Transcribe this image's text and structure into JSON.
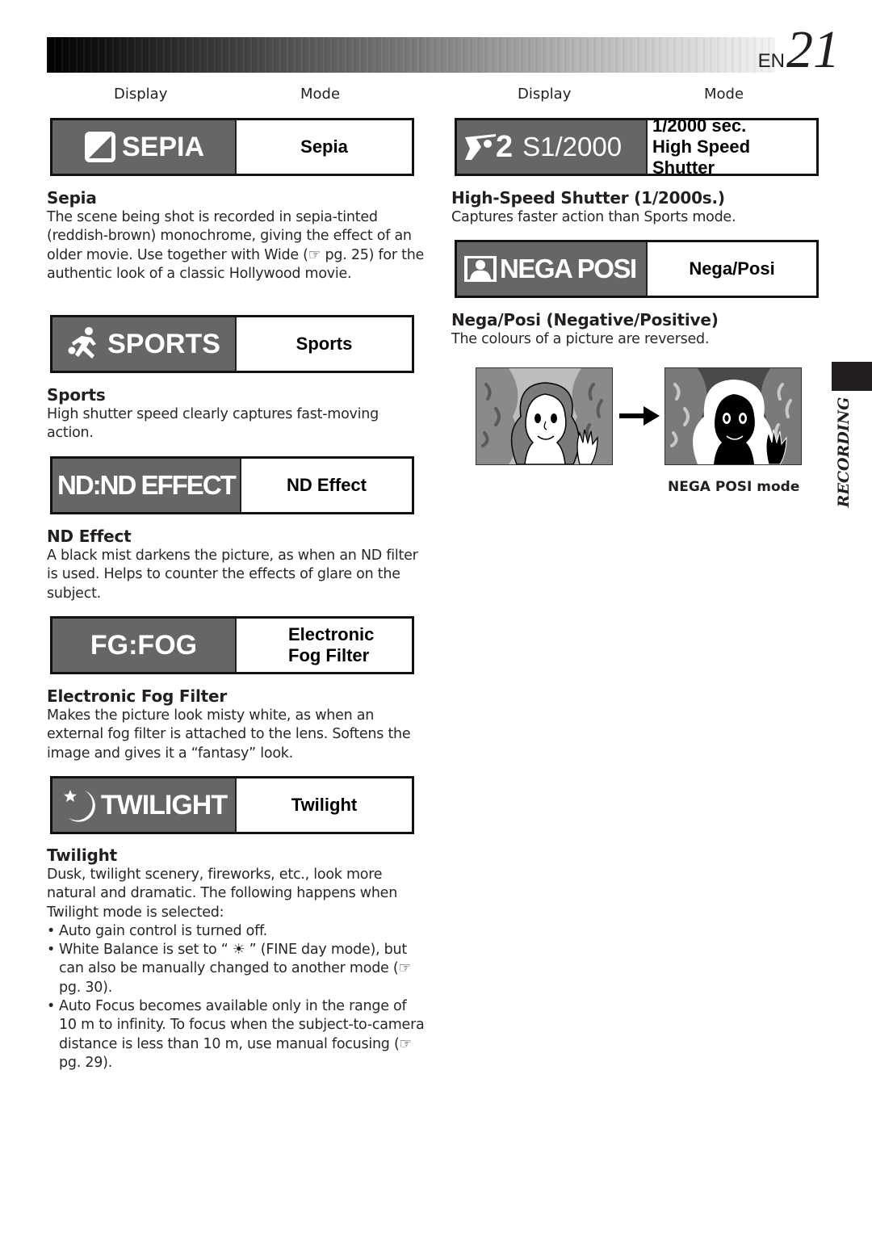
{
  "header": {
    "prefix": "EN",
    "page_number": "21"
  },
  "columns": {
    "left": {
      "display": "Display",
      "mode": "Mode"
    },
    "right": {
      "display": "Display",
      "mode": "Mode"
    }
  },
  "sections": {
    "sepia": {
      "display_text": "SEPIA",
      "display_icon": "sepia-icon",
      "mode_label": "Sepia",
      "title": "Sepia",
      "body": "The scene being shot is recorded in sepia-tinted (reddish-brown) monochrome, giving the effect of an older movie. Use together with Wide (☞ pg. 25) for the authentic look of a classic Hollywood movie."
    },
    "sports": {
      "display_text": "SPORTS",
      "display_icon": "sports-runner-icon",
      "mode_label": "Sports",
      "title": "Sports",
      "body": "High shutter speed clearly captures fast-moving action."
    },
    "nd_effect": {
      "display_text": "ND:ND EFFECT",
      "mode_label": "ND Effect",
      "title": "ND Effect",
      "body": "A black mist darkens the picture, as when an ND filter is used. Helps to counter the effects of glare on the subject."
    },
    "fog": {
      "display_text": "FG:FOG",
      "mode_label_line1": "Electronic",
      "mode_label_line2": "Fog Filter",
      "title": "Electronic Fog Filter",
      "body": "Makes the picture look misty white, as when an external fog filter is attached to the lens. Softens the image and gives it a “fantasy” look."
    },
    "twilight": {
      "display_text": "TWILIGHT",
      "display_icon": "moon-star-icon",
      "mode_label": "Twilight",
      "title": "Twilight",
      "body": "Dusk, twilight scenery, fireworks, etc., look more natural and dramatic. The following happens when Twilight mode is selected:",
      "bullets": [
        "Auto gain control is turned off.",
        "White Balance is set to “ ☀ ” (FINE day mode), but can also be manually changed to another mode (☞ pg. 30).",
        "Auto Focus becomes available only in the range of 10 m to infinity. To focus when the subject-to-camera distance is less than 10 m, use manual focusing (☞ pg. 29)."
      ]
    },
    "high_speed": {
      "display_prefix": "2",
      "display_text": "S1/2000",
      "display_icon": "golfer-icon",
      "mode_label_line1": "1/2000 sec.",
      "mode_label_line2": "High Speed Shutter",
      "title": "High-Speed Shutter (1/2000s.)",
      "body": "Captures faster action than Sports mode."
    },
    "nega_posi": {
      "display_text": "NEGA POSI",
      "display_icon": "portrait-icon",
      "mode_label": "Nega/Posi",
      "title": "Nega/Posi (Negative/Positive)",
      "body": "The colours of a picture are reversed.",
      "caption": "NEGA POSI mode"
    }
  },
  "side_tab": {
    "label": "RECORDING"
  },
  "colors": {
    "display_bg": "#666666",
    "text": "#231f20",
    "tab": "#231f20"
  }
}
